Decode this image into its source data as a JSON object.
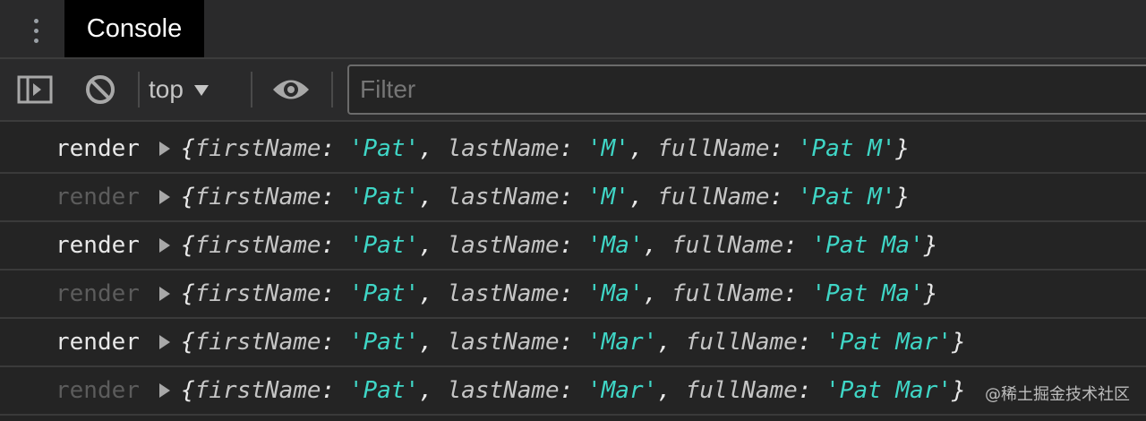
{
  "panel": {
    "tab_label": "Console"
  },
  "toolbar": {
    "context": "top",
    "filter_placeholder": "Filter"
  },
  "logs": [
    {
      "label": "render",
      "dim": false,
      "firstName": "'Pat'",
      "lastName": "'M'",
      "fullName": "'Pat M'"
    },
    {
      "label": "render",
      "dim": true,
      "firstName": "'Pat'",
      "lastName": "'M'",
      "fullName": "'Pat M'"
    },
    {
      "label": "render",
      "dim": false,
      "firstName": "'Pat'",
      "lastName": "'Ma'",
      "fullName": "'Pat Ma'"
    },
    {
      "label": "render",
      "dim": true,
      "firstName": "'Pat'",
      "lastName": "'Ma'",
      "fullName": "'Pat Ma'"
    },
    {
      "label": "render",
      "dim": false,
      "firstName": "'Pat'",
      "lastName": "'Mar'",
      "fullName": "'Pat Mar'"
    },
    {
      "label": "render",
      "dim": true,
      "firstName": "'Pat'",
      "lastName": "'Mar'",
      "fullName": "'Pat Mar'"
    }
  ],
  "keys": {
    "first": "firstName",
    "last": "lastName",
    "full": "fullName"
  },
  "watermark": "@稀土掘金技术社区",
  "colors": {
    "string": "#3fd6c6",
    "background": "#242424"
  }
}
